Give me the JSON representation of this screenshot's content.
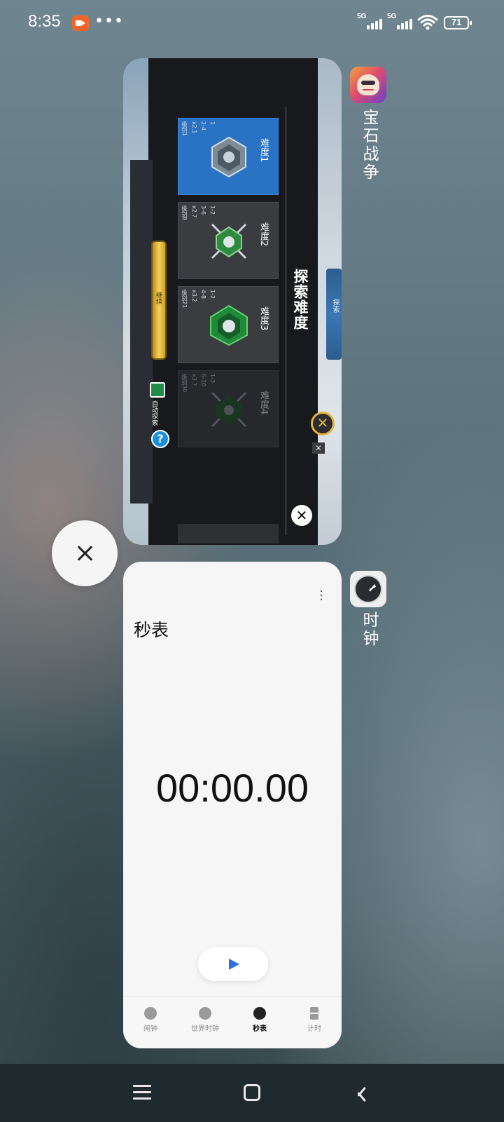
{
  "status_bar": {
    "time": "8:35",
    "network_1": "5G",
    "network_2": "5G",
    "battery": "71"
  },
  "recents": {
    "cards": [
      {
        "app_name": "宝石战争",
        "icon": "gem-wars-app-icon",
        "content": {
          "title": "探索难度",
          "levels": [
            {
              "name": "难度1",
              "stats": [
                "级别1",
                "x2.1",
                "2-4",
                "1"
              ]
            },
            {
              "name": "难度2",
              "stats": [
                "级别8",
                "x2.7",
                "3-6",
                "1-2"
              ]
            },
            {
              "name": "难度3",
              "stats": [
                "级别21",
                "x3.2",
                "4-8",
                "1-2"
              ]
            },
            {
              "name": "难度4",
              "stats": [
                "级别30",
                "x3.7",
                "6-10",
                "1-3"
              ]
            }
          ],
          "continue_label": "继续",
          "auto_explore_label": "自动探索",
          "blue_emblem_label": "探索"
        }
      },
      {
        "app_name": "时钟",
        "icon": "clock-app-icon",
        "content": {
          "title": "秒表",
          "stopwatch_time": "00:00.00",
          "tabs": [
            {
              "label": "闹钟",
              "icon": "alarm-icon"
            },
            {
              "label": "世界时钟",
              "icon": "world-clock-icon"
            },
            {
              "label": "秒表",
              "icon": "stopwatch-icon",
              "active": true
            },
            {
              "label": "计时",
              "icon": "timer-icon"
            }
          ]
        }
      }
    ]
  },
  "colors": {
    "accent_blue": "#2f6fd8",
    "game_active_tile": "#2a72c4",
    "record_orange": "#f0662a"
  }
}
